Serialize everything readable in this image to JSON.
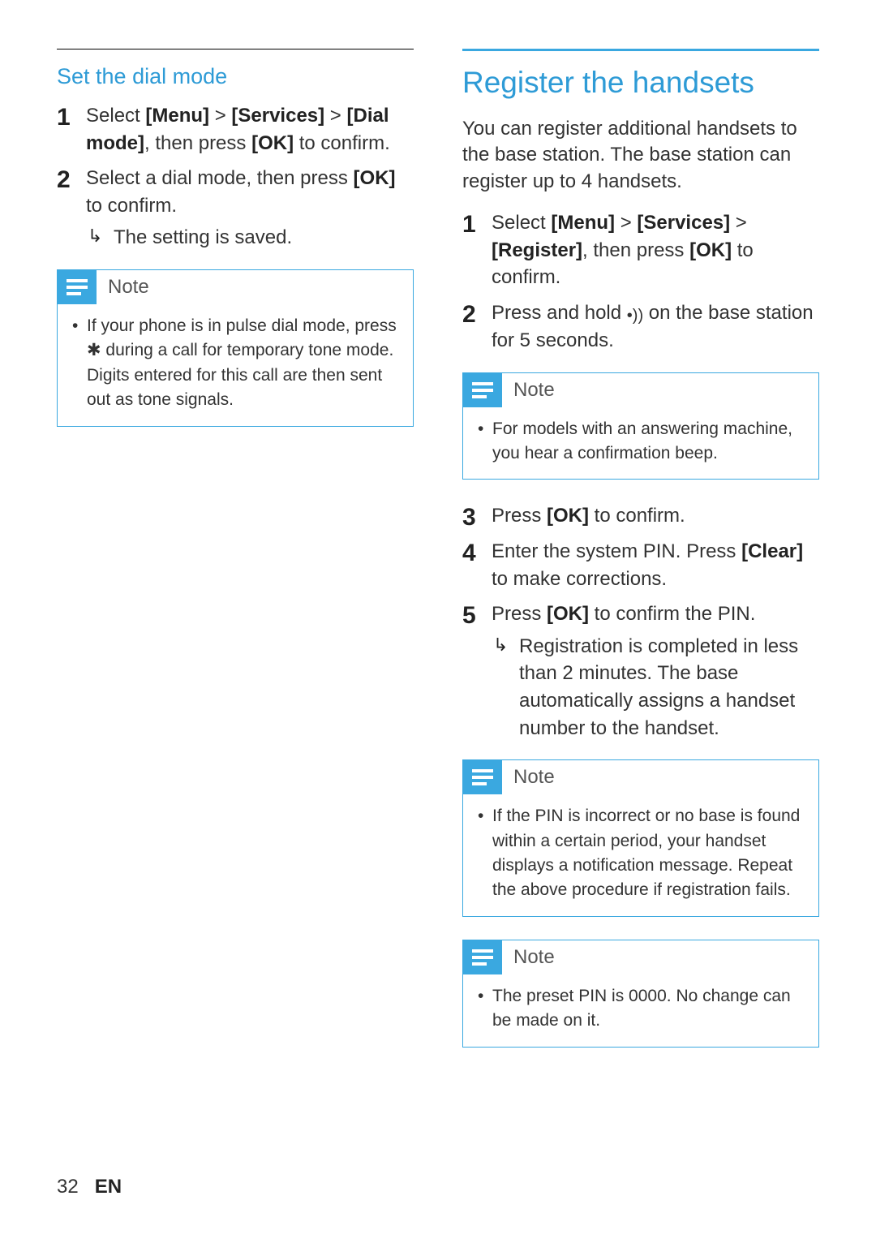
{
  "left": {
    "heading": "Set the dial mode",
    "steps": [
      {
        "html": "Select <b>[Menu]</b> > <b>[Services]</b> > <b>[Dial mode]</b>, then press <b>[OK]</b> to confirm."
      },
      {
        "html": "Select a dial mode, then press <b>[OK]</b> to confirm.",
        "result": "The setting is saved."
      }
    ],
    "note": {
      "label": "Note",
      "items": [
        "If your phone is in pulse dial mode, press ✱ during a call for temporary tone mode. Digits entered for this call are then sent out as tone signals."
      ]
    }
  },
  "right": {
    "heading": "Register the handsets",
    "intro": "You can register additional handsets to the base station. The base station can register up to 4 handsets.",
    "stepsA": [
      {
        "html": "Select <b>[Menu]</b> > <b>[Services]</b> > <b>[Register]</b>, then press <b>[OK]</b> to confirm."
      },
      {
        "html": "Press and hold <span class='inline-icon'>•))</span> on the base station for 5 seconds."
      }
    ],
    "note1": {
      "label": "Note",
      "items": [
        "For models with an answering machine, you hear a confirmation beep."
      ]
    },
    "stepsB": [
      {
        "html": "Press <b>[OK]</b> to confirm."
      },
      {
        "html": "Enter the system PIN. Press <b>[Clear]</b> to make corrections."
      },
      {
        "html": "Press <b>[OK]</b> to confirm the PIN.",
        "result": "Registration is completed in less than 2 minutes. The base automatically assigns a handset number to the handset."
      }
    ],
    "note2": {
      "label": "Note",
      "items": [
        "If the PIN is incorrect or no base is found within a certain period, your handset displays a notification message. Repeat the above procedure if registration fails."
      ]
    },
    "note3": {
      "label": "Note",
      "items": [
        "The preset PIN is 0000. No change can be made on it."
      ]
    }
  },
  "footer": {
    "page": "32",
    "lang": "EN"
  }
}
